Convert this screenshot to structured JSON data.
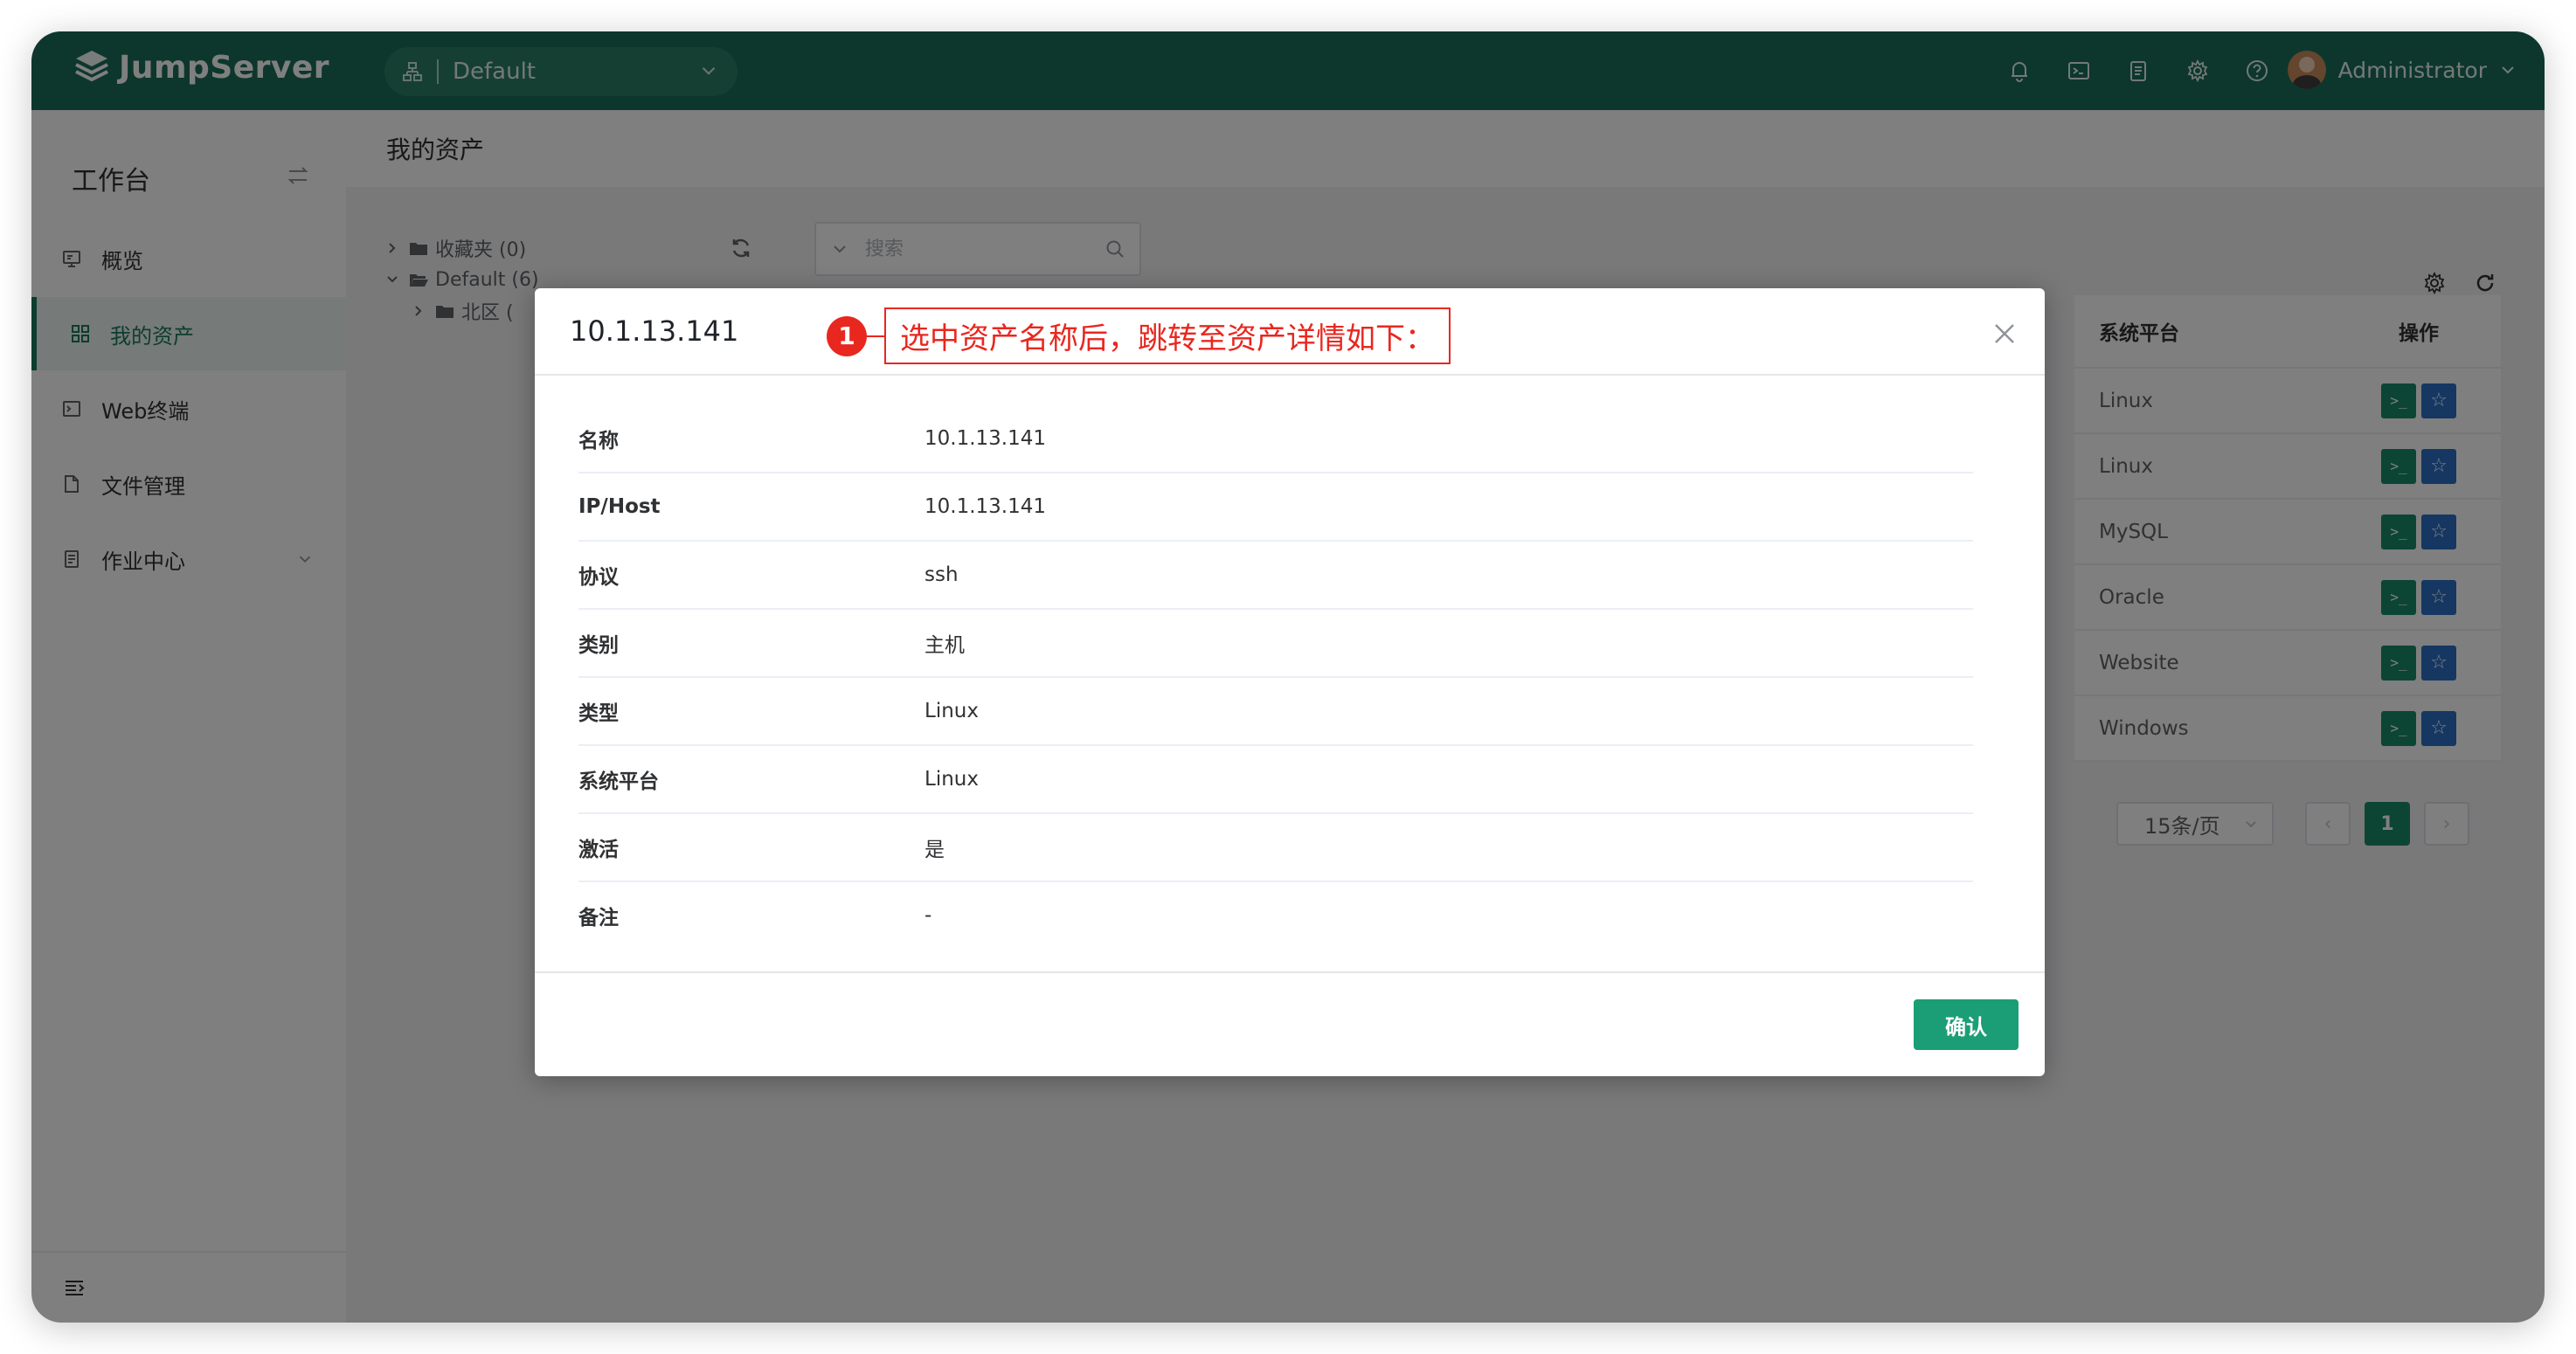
{
  "app": {
    "name": "JumpServer"
  },
  "navbar": {
    "org_name": "Default",
    "icons": [
      "bell-icon",
      "terminal-icon",
      "clipboard-icon",
      "gear-icon",
      "help-icon"
    ],
    "user_name": "Administrator"
  },
  "sidebar": {
    "title": "工作台",
    "items": [
      {
        "label": "概览",
        "icon": "monitor-icon"
      },
      {
        "label": "我的资产",
        "icon": "grid-icon",
        "active": true
      },
      {
        "label": "Web终端",
        "icon": "terminal-icon"
      },
      {
        "label": "文件管理",
        "icon": "file-icon"
      },
      {
        "label": "作业中心",
        "icon": "job-icon",
        "expandable": true
      }
    ]
  },
  "page": {
    "title": "我的资产"
  },
  "tree": {
    "nodes": [
      {
        "label": "收藏夹 (0)",
        "expanded": false
      },
      {
        "label": "Default (6)",
        "expanded": true
      },
      {
        "label": "北区 (",
        "expanded": false
      }
    ]
  },
  "search": {
    "placeholder": "搜索"
  },
  "table": {
    "columns": [
      "系统平台",
      "操作"
    ],
    "rows": [
      {
        "platform": "Linux"
      },
      {
        "platform": "Linux"
      },
      {
        "platform": "MySQL"
      },
      {
        "platform": "Oracle"
      },
      {
        "platform": "Website"
      },
      {
        "platform": "Windows"
      }
    ],
    "op_terminal_symbol": ">_",
    "op_star_symbol": "☆"
  },
  "pagination": {
    "page_size": "15条/页",
    "current_page": "1",
    "prev": "‹",
    "next": "›"
  },
  "dialog": {
    "title": "10.1.13.141",
    "annotation_number": "1",
    "annotation_text": "选中资产名称后，跳转至资产详情如下：",
    "fields": [
      {
        "label": "名称",
        "value": "10.1.13.141"
      },
      {
        "label": "IP/Host",
        "value": "10.1.13.141"
      },
      {
        "label": "协议",
        "value": "ssh"
      },
      {
        "label": "类别",
        "value": "主机"
      },
      {
        "label": "类型",
        "value": "Linux"
      },
      {
        "label": "系统平台",
        "value": "Linux"
      },
      {
        "label": "激活",
        "value": "是"
      },
      {
        "label": "备注",
        "value": "-"
      }
    ],
    "confirm_label": "确认"
  },
  "colors": {
    "brand": "#1b6f58",
    "primary": "#1b8a6a",
    "annotation": "#e8271f",
    "star_button": "#2a6fc5"
  }
}
